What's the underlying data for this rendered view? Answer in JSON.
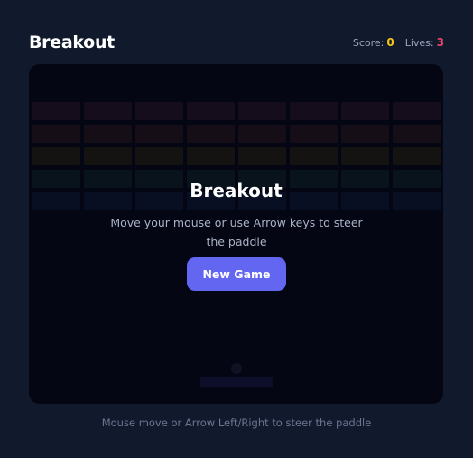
{
  "header": {
    "title": "Breakout",
    "score_label": "Score:",
    "score_value": "0",
    "lives_label": "Lives:",
    "lives_value": "3"
  },
  "colors": {
    "score": "#f5c518",
    "lives": "#f0466a",
    "button": "#6366f1",
    "brick_rows": [
      "#2a1426",
      "#2a1a1a",
      "#2a2410",
      "#0e2426",
      "#101c33"
    ]
  },
  "game": {
    "brick_rows": 5,
    "brick_columns": 8
  },
  "overlay": {
    "title": "Breakout",
    "instructions": "Move your mouse or use Arrow keys to steer the paddle",
    "button_label": "New Game"
  },
  "footer": {
    "hint": "Mouse move or Arrow Left/Right to steer the paddle"
  }
}
